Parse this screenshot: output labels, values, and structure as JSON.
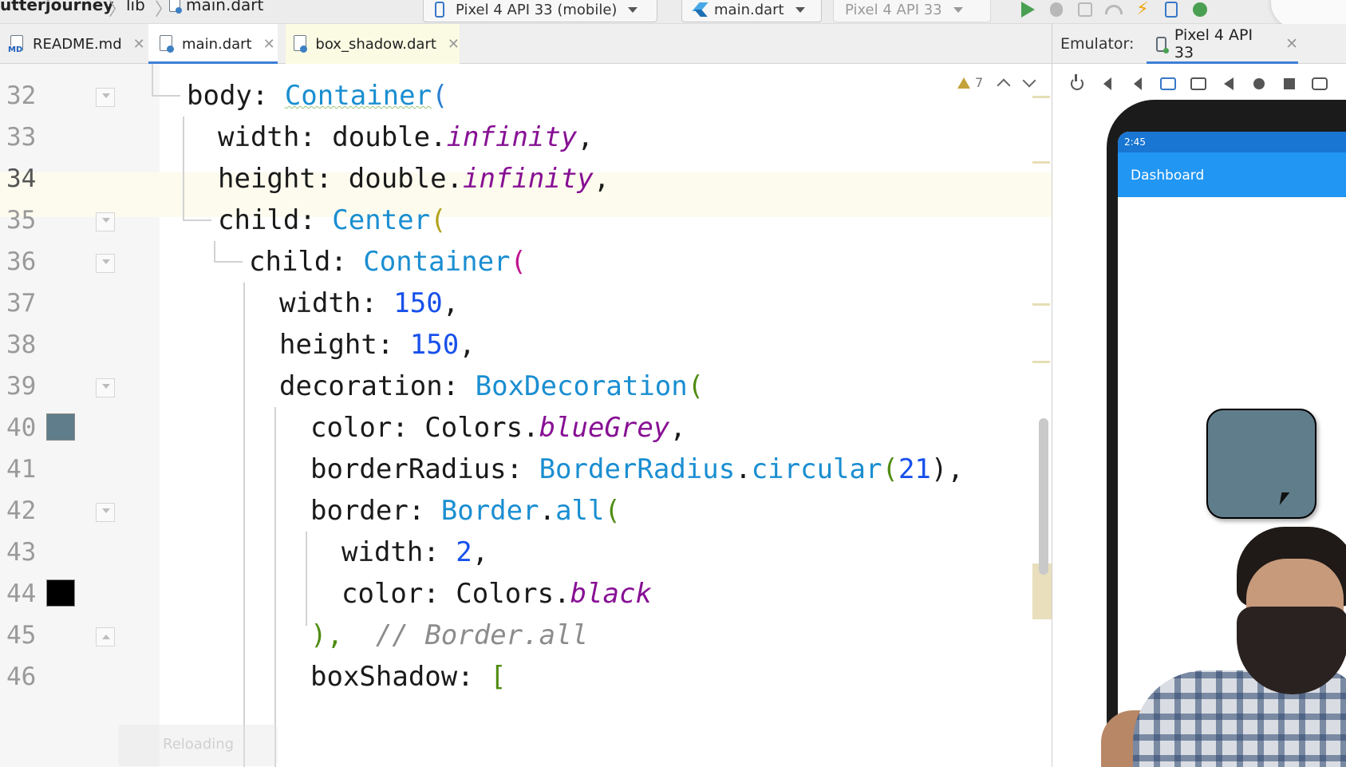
{
  "breadcrumb": {
    "project": "utterjourney",
    "folder": "lib",
    "file": "main.dart"
  },
  "toolbar": {
    "device_selector": "Pixel 4 API 33 (mobile)",
    "run_config": "main.dart",
    "avd_selector": "Pixel 4 API 33",
    "icons": [
      "run-icon",
      "debug-icon",
      "attach-icon",
      "profiler-icon",
      "hot-reload-icon",
      "device-manager-icon",
      "app-inspection-icon"
    ]
  },
  "tabs": [
    {
      "label": "README.md",
      "icon": "markdown-file-icon",
      "active": false
    },
    {
      "label": "main.dart",
      "icon": "dart-file-icon",
      "active": true
    },
    {
      "label": "box_shadow.dart",
      "icon": "dart-file-icon",
      "active": false
    }
  ],
  "emulator": {
    "label": "Emulator:",
    "tab": "Pixel 4 API 33",
    "status_time": "2:45",
    "app_bar_title": "Dashboard",
    "box_color": "#607d8b",
    "controls": [
      "power-icon",
      "volume-up-icon",
      "volume-down-icon",
      "rotate-left-icon",
      "rotate-right-icon",
      "back-icon",
      "home-icon",
      "overview-icon",
      "screenshot-icon"
    ]
  },
  "editor": {
    "warning_count": "7",
    "current_line": "34",
    "overlay_text": "Reloading",
    "swatches": {
      "line_40": "#607d8b",
      "line_44": "#000000"
    },
    "lines": [
      {
        "n": "32",
        "parts": [
          "body: ",
          "Container",
          "("
        ]
      },
      {
        "n": "33",
        "parts": [
          "width: double.",
          "infinity",
          ","
        ]
      },
      {
        "n": "34",
        "parts": [
          "height: double.",
          "infinity",
          ","
        ]
      },
      {
        "n": "35",
        "parts": [
          "child: ",
          "Center",
          "("
        ]
      },
      {
        "n": "36",
        "parts": [
          "child: ",
          "Container",
          "("
        ]
      },
      {
        "n": "37",
        "parts": [
          "width: ",
          "150",
          ","
        ]
      },
      {
        "n": "38",
        "parts": [
          "height: ",
          "150",
          ","
        ]
      },
      {
        "n": "39",
        "parts": [
          "decoration: ",
          "BoxDecoration",
          "("
        ]
      },
      {
        "n": "40",
        "parts": [
          "color: Colors.",
          "blueGrey",
          ","
        ]
      },
      {
        "n": "41",
        "parts": [
          "borderRadius: ",
          "BorderRadius",
          ".",
          "circular",
          "(",
          "21",
          "),"
        ]
      },
      {
        "n": "42",
        "parts": [
          "border: ",
          "Border",
          ".",
          "all",
          "("
        ]
      },
      {
        "n": "43",
        "parts": [
          "width: ",
          "2",
          ","
        ]
      },
      {
        "n": "44",
        "parts": [
          "color: Colors.",
          "black"
        ]
      },
      {
        "n": "45",
        "parts": [
          "),",
          "// Border.all"
        ]
      },
      {
        "n": "46",
        "parts": [
          "boxShadow: ",
          "["
        ]
      }
    ]
  }
}
